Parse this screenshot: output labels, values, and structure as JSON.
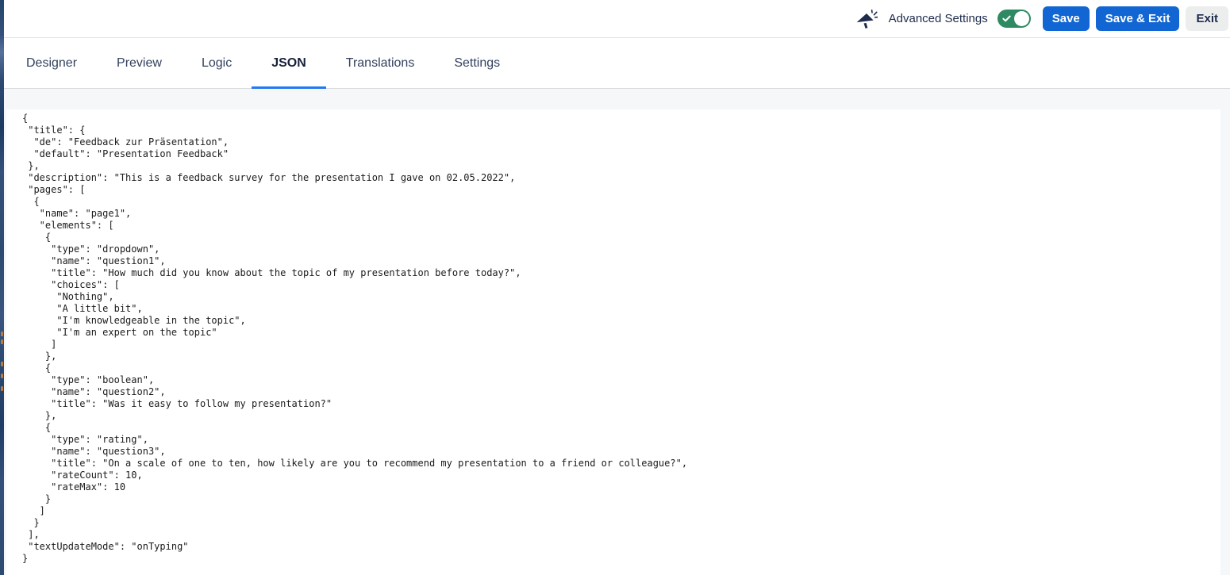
{
  "topbar": {
    "announcement_icon": "megaphone-icon",
    "advanced_settings_label": "Advanced Settings",
    "advanced_settings_toggle_state": "on",
    "save_label": "Save",
    "save_exit_label": "Save & Exit",
    "exit_label": "Exit",
    "colors": {
      "primary_button_blue": "#1266d3",
      "toggle_green": "#2e8a62",
      "exit_button_gray": "#eceded",
      "icon_text_navy": "#1d2b4c"
    }
  },
  "tabs": {
    "active_tab": "JSON",
    "underline_color": "#2478f2",
    "items": [
      {
        "label": "Designer",
        "active": false
      },
      {
        "label": "Preview",
        "active": false
      },
      {
        "label": "Logic",
        "active": false
      },
      {
        "label": "JSON",
        "active": true
      },
      {
        "label": "Translations",
        "active": false
      },
      {
        "label": "Settings",
        "active": false
      }
    ]
  },
  "editor": {
    "language": "json",
    "code_lines": [
      "{",
      " \"title\": {",
      "  \"de\": \"Feedback zur Präsentation\",",
      "  \"default\": \"Presentation Feedback\"",
      " },",
      " \"description\": \"This is a feedback survey for the presentation I gave on 02.05.2022\",",
      " \"pages\": [",
      "  {",
      "   \"name\": \"page1\",",
      "   \"elements\": [",
      "    {",
      "     \"type\": \"dropdown\",",
      "     \"name\": \"question1\",",
      "     \"title\": \"How much did you know about the topic of my presentation before today?\",",
      "     \"choices\": [",
      "      \"Nothing\",",
      "      \"A little bit\",",
      "      \"I'm knowledgeable in the topic\",",
      "      \"I'm an expert on the topic\"",
      "     ]",
      "    },",
      "    {",
      "     \"type\": \"boolean\",",
      "     \"name\": \"question2\",",
      "     \"title\": \"Was it easy to follow my presentation?\"",
      "    },",
      "    {",
      "     \"type\": \"rating\",",
      "     \"name\": \"question3\",",
      "     \"title\": \"On a scale of one to ten, how likely are you to recommend my presentation to a friend or colleague?\",",
      "     \"rateCount\": 10,",
      "     \"rateMax\": 10",
      "    }",
      "   ]",
      "  }",
      " ],",
      " \"textUpdateMode\": \"onTyping\"",
      "}"
    ]
  }
}
